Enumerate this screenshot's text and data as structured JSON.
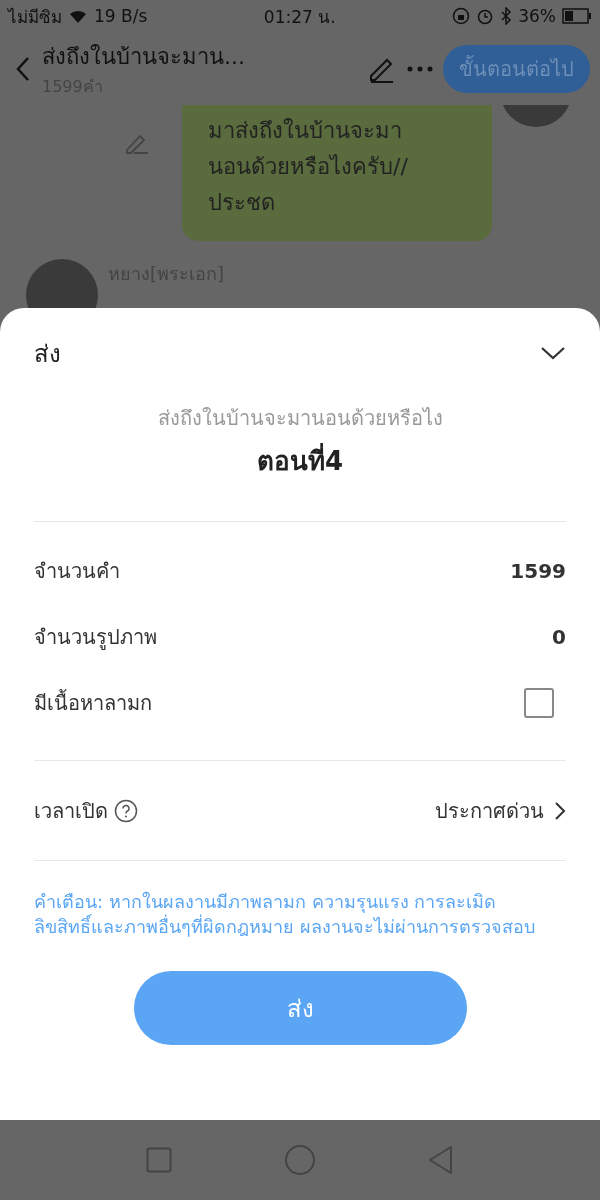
{
  "status_bar": {
    "carrier": "ไม่มีซิม",
    "speed": "19 B/s",
    "time": "01:27 น.",
    "battery": "36%"
  },
  "header": {
    "title": "ส่งถึงในบ้านจะมาน...",
    "word_count": "1599คำ",
    "next_button": "ขั้นตอนต่อไป"
  },
  "chat": {
    "message_lines": [
      "มาส่งถึงในบ้านจะมา",
      "นอนด้วยหรือไงครับ//",
      "ประชด"
    ],
    "author": "หยาง[พระเอก]"
  },
  "sheet": {
    "title": "ส่ง",
    "story_title": "ส่งถึงในบ้านจะมานอนด้วยหรือไง",
    "chapter": "ตอนที่4",
    "rows": [
      {
        "kind": "value",
        "label": "จำนวนคำ",
        "value": "1599"
      },
      {
        "kind": "value",
        "label": "จำนวนรูปภาพ",
        "value": "0"
      },
      {
        "kind": "checkbox",
        "label": "มีเนื้อหาลามก",
        "checked": false
      }
    ],
    "open_time": {
      "label": "เวลาเปิด",
      "value": "ประกาศด่วน"
    },
    "warning": "คำเตือน: หากในผลงานมีภาพลามก ความรุนแรง การละเมิดลิขสิทธิ์และภาพอื่นๆที่ผิดกฎหมาย ผลงานจะไม่ผ่านการตรวจสอบ",
    "submit_button": "ส่ง"
  }
}
